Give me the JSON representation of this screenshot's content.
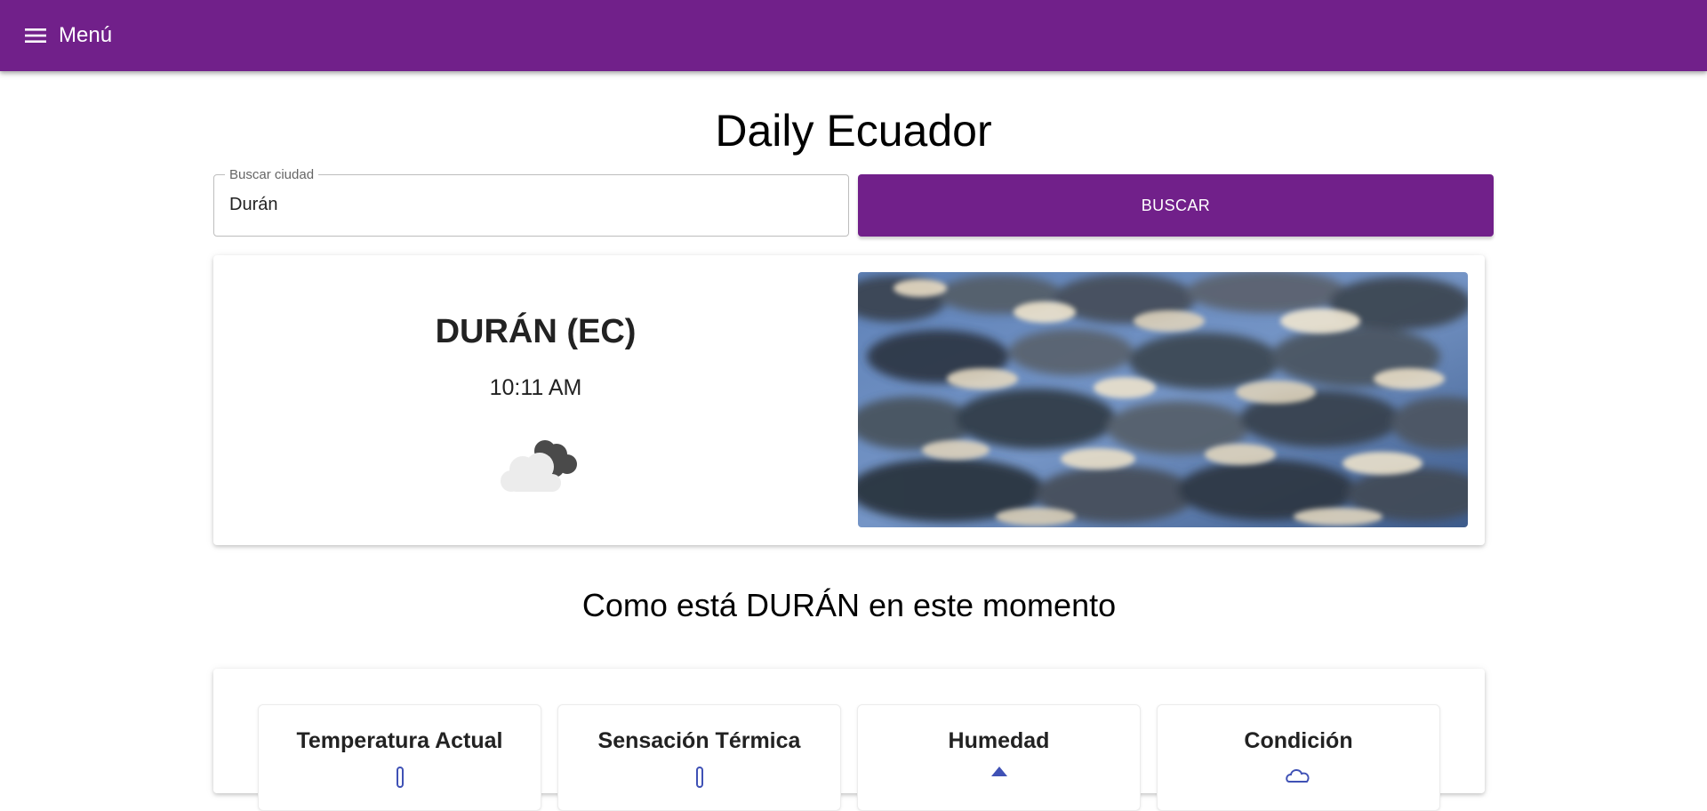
{
  "appbar": {
    "menu_label": "Menú",
    "menu_icon": "hamburger-icon",
    "color": "#71208a"
  },
  "page": {
    "title": "Daily Ecuador"
  },
  "search": {
    "label": "Buscar ciudad",
    "value": "Durán",
    "button_label": "BUSCAR"
  },
  "city": {
    "name": "DURÁN (EC)",
    "time": "10:11 AM",
    "weather_icon": "cloudy-night-icon",
    "photo": "cloudy-sky-photo"
  },
  "current": {
    "heading": "Como está DURÁN en este momento",
    "metrics": [
      {
        "title": "Temperatura Actual",
        "icon": "thermometer-icon"
      },
      {
        "title": "Sensación Térmica",
        "icon": "thermometer-icon"
      },
      {
        "title": "Humedad",
        "icon": "droplet-icon"
      },
      {
        "title": "Condición",
        "icon": "cloud-icon"
      }
    ]
  }
}
